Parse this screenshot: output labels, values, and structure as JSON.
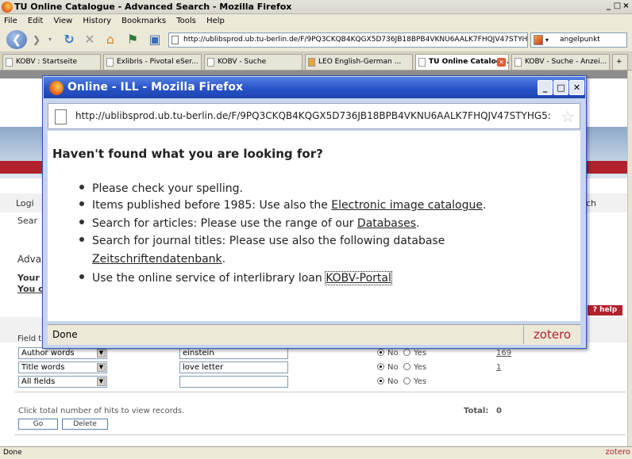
{
  "main_window": {
    "title": "TU Online Catalogue - Advanced Search - Mozilla Firefox",
    "controls": [
      "_",
      "□",
      "×"
    ]
  },
  "menu": [
    "File",
    "Edit",
    "View",
    "History",
    "Bookmarks",
    "Tools",
    "Help"
  ],
  "nav": {
    "url": "http://ublibsprod.ub.tu-berlin.de/F/9PQ3CKQB4KQGX5D736JB18BPB4VKNU6AALK7FHQJV47STYHG5›",
    "search_value": "angelpunkt"
  },
  "tabs": [
    {
      "label": "KOBV : Startseite"
    },
    {
      "label": "Exlibris - Pivotal eSer..."
    },
    {
      "label": "KOBV - Suche"
    },
    {
      "label": "LEO English-German ..."
    },
    {
      "label": "TU Online Catalog..."
    },
    {
      "label": "KOBV - Suche - Anzei..."
    }
  ],
  "background_page": {
    "nav_label_1": "Logi",
    "nav_label_2": "ch",
    "search_label": "Sear",
    "adv_label": "Adva",
    "your_label": "Your",
    "you_link": "You c",
    "help_label": "? help",
    "field_label": "Field t",
    "rows": [
      {
        "field": "Author words",
        "value": "einstein",
        "no": "No",
        "yes": "Yes",
        "hits": "169",
        "no_selected": true
      },
      {
        "field": "Title words",
        "value": "love letter",
        "no": "No",
        "yes": "Yes",
        "hits": "1",
        "no_selected": true
      },
      {
        "field": "All fields",
        "value": "",
        "no": "No",
        "yes": "Yes",
        "hits": "",
        "no_selected": true
      }
    ],
    "hint": "Click total number of hits to view records.",
    "total_label": "Total:",
    "total_value": "0",
    "go_label": "Go",
    "delete_label": "Delete"
  },
  "status": {
    "text": "Done",
    "zotero": "zotero"
  },
  "popup": {
    "title": "Online - ILL - Mozilla Firefox",
    "url": "http://ublibsprod.ub.tu-berlin.de/F/9PQ3CKQB4KQGX5D736JB18BPB4VKNU6AALK7FHQJV47STYHG5:",
    "heading": "Haven't found what you are looking for?",
    "b1": "Please check your spelling.",
    "b2_text": "Items published before 1985: Use also the ",
    "b2_link": "Electronic image catalogue",
    "b2_tail": ".",
    "b3_text": "Search for articles: Please use the range of our ",
    "b3_link": "Databases",
    "b3_tail": ".",
    "b4_text": "Search for journal titles: Please use also the following database",
    "b4_link": "Zeitschriftendatenbank",
    "b4_tail": ".",
    "b5_text": "Use the online service of interlibrary loan ",
    "b5_link": "KOBV-Portal",
    "b5_tail": ".",
    "status": "Done",
    "zotero": "zotero"
  },
  "colors": {
    "accent_red": "#b1222c",
    "titlebar_blue": "#2653c8"
  }
}
